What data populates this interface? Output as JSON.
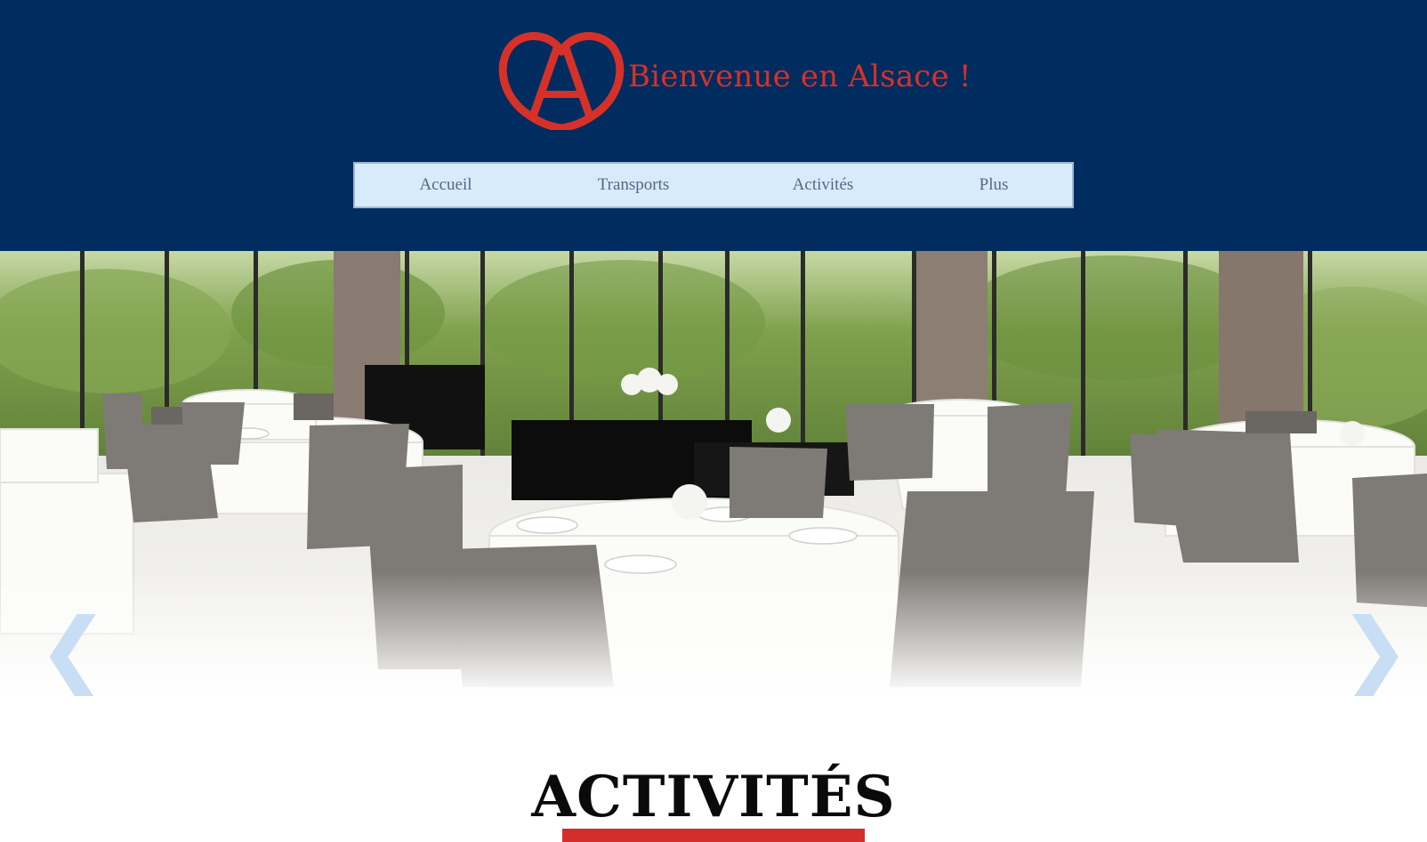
{
  "header": {
    "title": "Bienvenue en Alsace !",
    "logo_icon": "alsace-heart-a-logo",
    "background_color": "#002c5f",
    "accent_color": "#d63128"
  },
  "nav": {
    "items": [
      {
        "label": "Accueil"
      },
      {
        "label": "Transports"
      },
      {
        "label": "Activités"
      },
      {
        "label": "Plus"
      }
    ],
    "background_color": "#d8ebfb",
    "text_color": "#4e6a86"
  },
  "slideshow": {
    "image": "restaurant-dining-room-photo",
    "prev_arrow": "❮",
    "next_arrow": "❯"
  },
  "section": {
    "title": "ACTIVITÉS",
    "rule_color": "#d42e2a"
  }
}
